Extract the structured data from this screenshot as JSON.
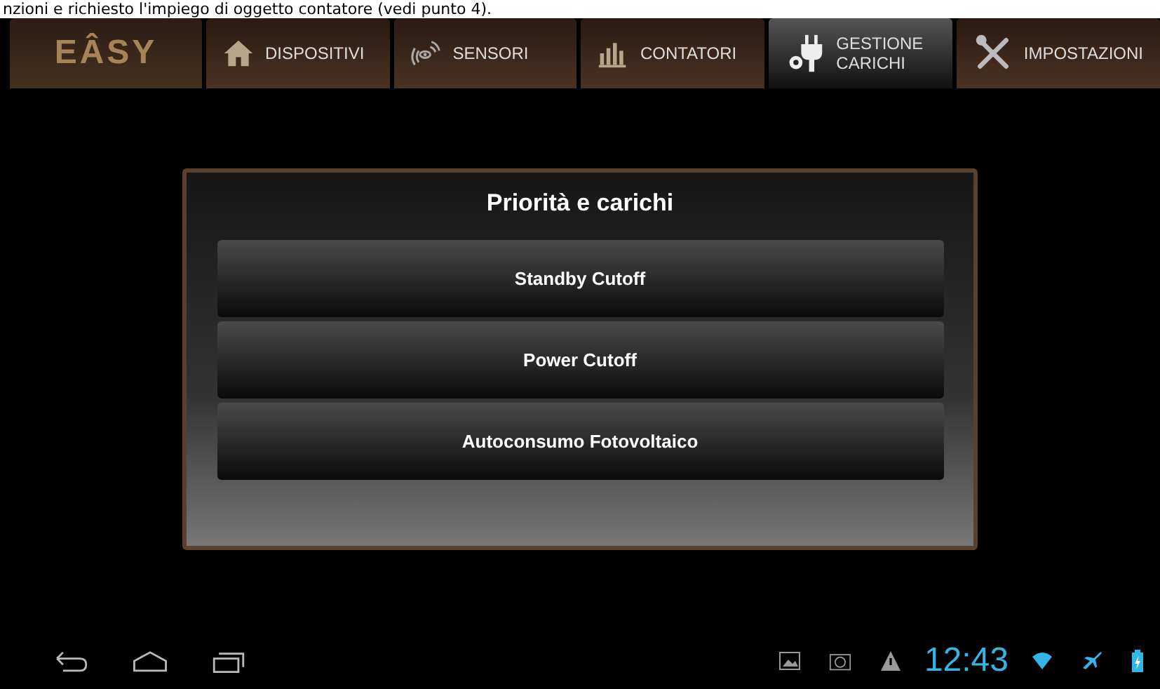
{
  "document_line": "nzioni e richiesto l'impiego di oggetto contatore (vedi punto 4).",
  "logo": "EÂSY",
  "tabs": [
    {
      "label": "DISPOSITIVI",
      "kind": "house",
      "selected": false
    },
    {
      "label": "SENSORI",
      "kind": "sensor",
      "selected": false
    },
    {
      "label": "CONTATORI",
      "kind": "bars",
      "selected": false
    },
    {
      "label": "GESTIONE CARICHI",
      "kind": "plug",
      "selected": true
    },
    {
      "label": "IMPOSTAZIONI",
      "kind": "tools",
      "selected": false
    }
  ],
  "panel": {
    "title": "Priorità e carichi",
    "buttons": [
      "Standby Cutoff",
      "Power Cutoff",
      "Autoconsumo Fotovoltaico"
    ]
  },
  "status_bar": {
    "time": "12:43"
  }
}
